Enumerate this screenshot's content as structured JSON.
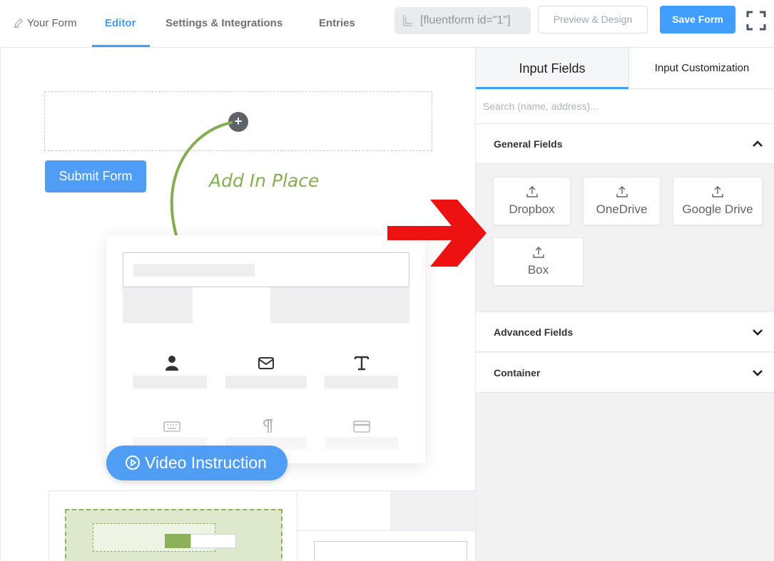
{
  "nav": {
    "your_form": "Your Form",
    "editor": "Editor",
    "settings": "Settings & Integrations",
    "entries": "Entries",
    "shortcode": "[fluentform id=\"1\"]",
    "preview": "Preview & Design",
    "save": "Save Form"
  },
  "editor": {
    "submit_label": "Submit Form",
    "annotation": "Add In Place",
    "plus": "+",
    "video_label": "Video Instruction"
  },
  "panel": {
    "tabs": [
      "Input Fields",
      "Input Customization"
    ],
    "search_placeholder": "Search (name, address)...",
    "sections": {
      "general": "General Fields",
      "advanced": "Advanced Fields",
      "container": "Container"
    },
    "general_fields": [
      "Dropbox",
      "OneDrive",
      "Google Drive",
      "Box"
    ]
  },
  "colors": {
    "accent": "#409eff",
    "annotation": "#86ad53",
    "arrow": "#ee1111"
  }
}
